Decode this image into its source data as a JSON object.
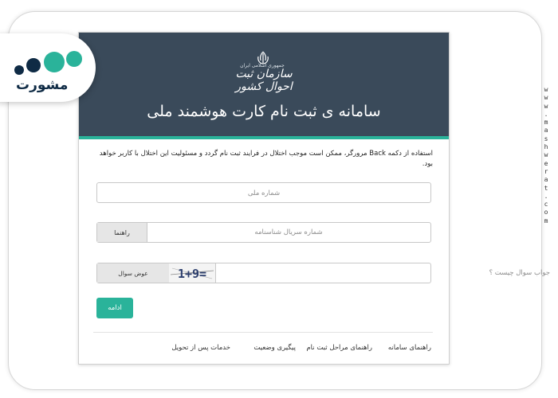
{
  "logo": {
    "word": "مشورت"
  },
  "watermark": {
    "chars": [
      "w",
      "w",
      "w",
      ".",
      "m",
      "a",
      "s",
      "h",
      "w",
      "e",
      "r",
      "a",
      "t",
      ".",
      "c",
      "o",
      "m"
    ]
  },
  "header": {
    "org_sub": "جمهوری اسلامی ایران",
    "org_name": "سازمان ثبت احوال کشور",
    "title": "سامانه ی ثبت نام کارت هوشمند ملی"
  },
  "warning": "استفاده از دکمه Back مرورگر، ممکن است موجب اختلال در فرایند ثبت نام گردد و مسئولیت این اختلال با کاربر خواهد بود.",
  "form": {
    "national_id_placeholder": "شماره ملی",
    "serial_placeholder": "شماره سریال شناسنامه",
    "guide_label": "راهنما",
    "captcha_placeholder": "جواب سوال چیست ؟",
    "change_question_label": "عوض سوال",
    "continue_label": "ادامه"
  },
  "captcha_text": "1+9=",
  "colors": {
    "header_bg": "#3a4a5a",
    "accent": "#2ab39a"
  },
  "footer": {
    "links": [
      "راهنمای سامانه",
      "راهنمای مراحل ثبت نام",
      "پیگیری وضعیت",
      "خدمات پس از تحویل"
    ]
  }
}
